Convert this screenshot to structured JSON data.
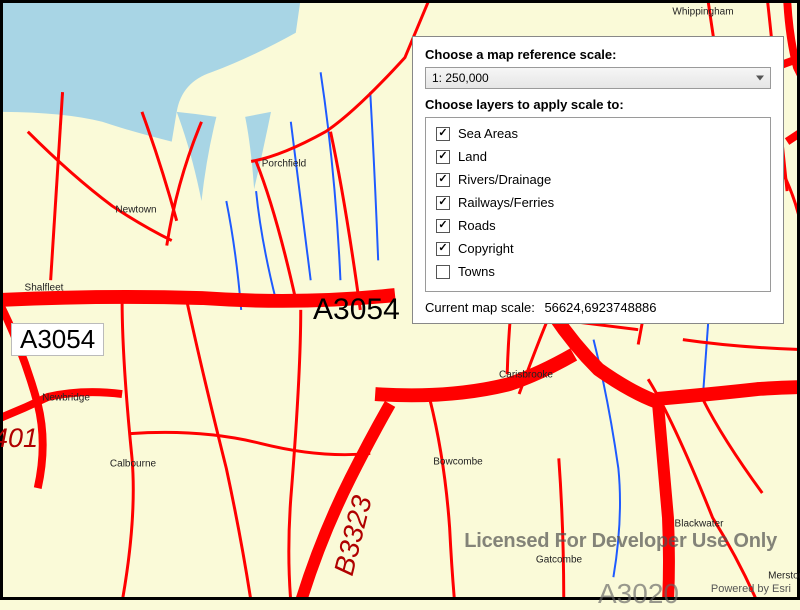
{
  "panel": {
    "heading_scale": "Choose a map reference scale:",
    "combo_value": "1: 250,000",
    "heading_layers": "Choose layers to apply scale to:",
    "layers": [
      {
        "label": "Sea Areas",
        "checked": true
      },
      {
        "label": "Land",
        "checked": true
      },
      {
        "label": "Rivers/Drainage",
        "checked": true
      },
      {
        "label": "Railways/Ferries",
        "checked": true
      },
      {
        "label": "Roads",
        "checked": true
      },
      {
        "label": "Copyright",
        "checked": true
      },
      {
        "label": "Towns",
        "checked": false
      }
    ],
    "current_scale_label": "Current map scale:",
    "current_scale_value": "56624,6923748886"
  },
  "road_labels": {
    "a3054_left": "A3054",
    "a3054_mid": "A3054",
    "a3020_bottom": "A3020",
    "b3401": "401",
    "b3323": "B3323"
  },
  "towns": {
    "newtown": "Newtown",
    "shalfleet": "Shalfleet",
    "porchfield": "Porchfield",
    "calbourne": "Calbourne",
    "carisbrooke": "Carisbrooke",
    "bowcombe": "Bowcombe",
    "blackwater": "Blackwater",
    "whippingham": "Whippingham",
    "gatcombe": "Gatcombe",
    "newbridge": "Newbridge",
    "merstone": "Merstone"
  },
  "watermark": "Licensed For Developer Use Only",
  "attribution": "Powered by Esri",
  "colors": {
    "land": "#fafad8",
    "sea": "#a8d5e5",
    "road_major": "#ff0000",
    "river": "#1e5aff",
    "road_label": "#b00000"
  }
}
